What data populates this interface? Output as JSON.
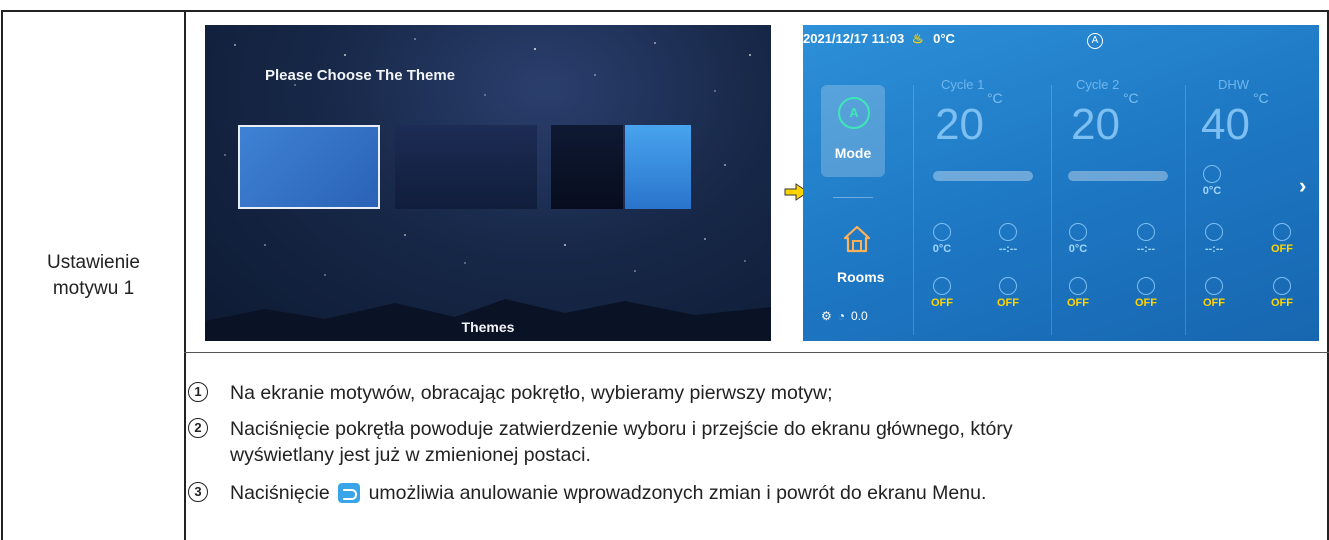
{
  "row_label": [
    "Ustawienie",
    "motywu 1"
  ],
  "theme_screen": {
    "title": "Please Choose The Theme",
    "footer_label": "Themes"
  },
  "main_screen": {
    "date_time": "2021/12/17 11:03",
    "outdoor_temp": "0°C",
    "mode_badge": "A",
    "columns": [
      {
        "name": "Cycle 1",
        "temp": "20",
        "unit": "°C"
      },
      {
        "name": "Cycle 2",
        "temp": "20",
        "unit": "°C"
      },
      {
        "name": "DHW",
        "temp": "40",
        "unit": "°C"
      }
    ],
    "mode_label": "Mode",
    "mode_icon_letter": "A",
    "rooms_label": "Rooms",
    "footer_value": "0.0",
    "dhw_status": "0°C",
    "grid": {
      "row1": [
        "0°C",
        "--:--",
        "0°C",
        "--:--",
        "--:--",
        "OFF"
      ],
      "row2": [
        "OFF",
        "OFF",
        "OFF",
        "OFF",
        "OFF",
        "OFF"
      ]
    }
  },
  "steps": [
    {
      "num": "1",
      "text": "Na ekranie motywów, obracając pokrętło, wybieramy pierwszy motyw;"
    },
    {
      "num": "2",
      "line1": "Naciśnięcie pokrętła powoduje zatwierdzenie wyboru i przejście do ekranu głównego, który",
      "line2": "wyświetlany jest już w zmienionej postaci."
    },
    {
      "num": "3",
      "before": "Naciśnięcie",
      "after": "umożliwia anulowanie wprowadzonych zmian i powrót do ekranu Menu."
    }
  ],
  "colors": {
    "screen_bg": "#1e78c4",
    "accent_green": "#3fe6b6",
    "arrow_yellow": "#ffd400"
  }
}
